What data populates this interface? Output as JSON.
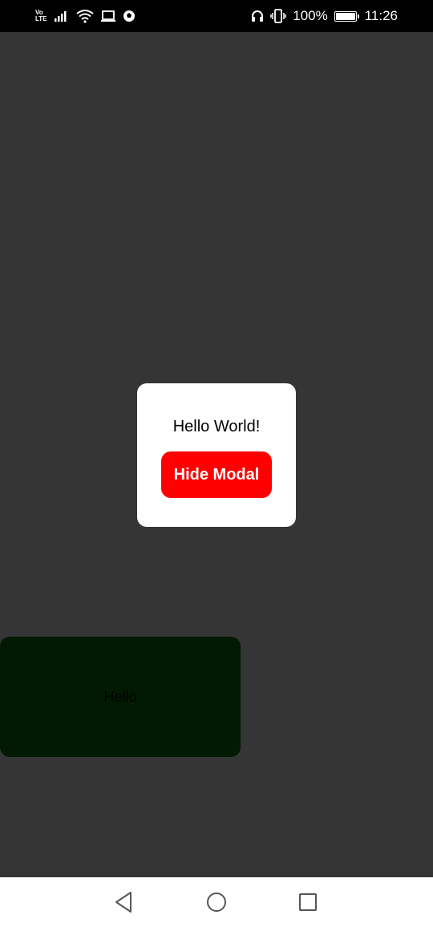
{
  "status_bar": {
    "network_top": "Vo",
    "network_bottom": "LTE",
    "battery_percent": "100%",
    "battery_level": 1.0,
    "time": "11:26",
    "icons": [
      "signal-icon",
      "wifi-icon",
      "laptop-icon",
      "soccer-ball-icon",
      "headphones-icon",
      "vibrate-icon",
      "battery-icon"
    ]
  },
  "modal": {
    "message": "Hello World!",
    "button_label": "Hide Modal",
    "button_color": "#ff0000"
  },
  "background_box": {
    "text": "Hello",
    "color": "#021a02"
  },
  "nav_bar": {
    "icons": [
      "back-icon",
      "home-icon",
      "recents-icon"
    ]
  },
  "colors": {
    "overlay": "#353535",
    "status_bar": "#000000",
    "nav_bar": "#ffffff"
  }
}
